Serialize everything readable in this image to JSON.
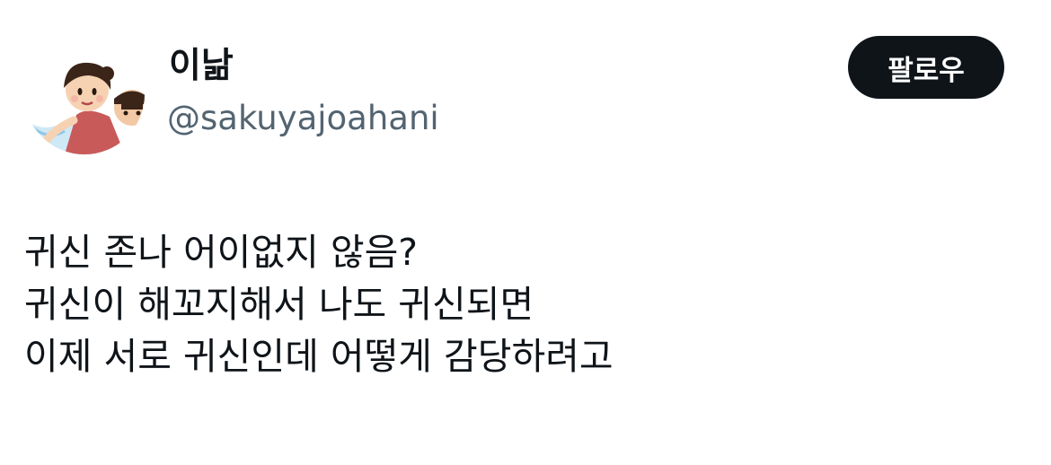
{
  "author": {
    "display_name": "이낢",
    "handle": "@sakuyajoahani",
    "avatar_icon": "cartoon-illustration-avatar"
  },
  "follow_button": {
    "label": "팔로우"
  },
  "tweet": {
    "lines": [
      "귀신 존나 어이없지 않음?",
      "귀신이 해꼬지해서 나도 귀신되면",
      "이제 서로 귀신인데 어떻게 감당하려고"
    ]
  },
  "colors": {
    "text_primary": "#0f1419",
    "text_secondary": "#536471",
    "button_bg": "#0f1419",
    "button_text": "#ffffff",
    "background": "#ffffff"
  }
}
